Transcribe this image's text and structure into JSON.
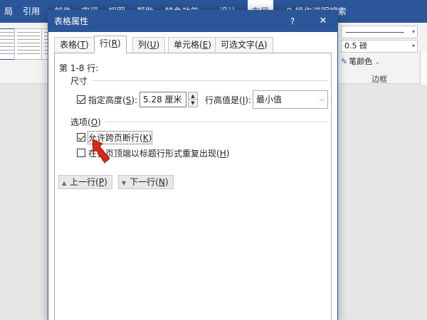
{
  "ribbon": {
    "tabs": [
      "局",
      "引用",
      "邮件",
      "审阅",
      "视图",
      "帮助",
      "特色功能",
      "设计",
      "布局",
      "♀ 操作说明搜索"
    ],
    "border_width": "0.5 磅",
    "pen_color": "笔颜色",
    "group_label": "边框",
    "accent": "#2b579a"
  },
  "dialog": {
    "title": "表格属性",
    "help": "?",
    "close": "✕",
    "tabs": [
      {
        "label": "表格",
        "key": "T"
      },
      {
        "label": "行",
        "key": "R"
      },
      {
        "label": "列",
        "key": "U"
      },
      {
        "label": "单元格",
        "key": "E"
      },
      {
        "label": "可选文字",
        "key": "A"
      }
    ],
    "active_tab": "行",
    "rows_label": "第 1-8 行:",
    "size_section": "尺寸",
    "specify_height": {
      "label": "指定高度",
      "key": "S",
      "checked": true
    },
    "height_value": "5.28 厘米",
    "row_height_is": {
      "label": "行高值是",
      "key": "I"
    },
    "row_height_mode": "最小值",
    "options_section": {
      "label": "选项",
      "key": "O"
    },
    "allow_break": {
      "label": "允许跨页断行",
      "key": "K",
      "checked": true
    },
    "repeat_header": {
      "label": "在各页顶端以标题行形式重复出现",
      "key": "H",
      "checked": false
    },
    "prev_row": {
      "label": "上一行",
      "key": "P"
    },
    "next_row": {
      "label": "下一行",
      "key": "N"
    }
  }
}
